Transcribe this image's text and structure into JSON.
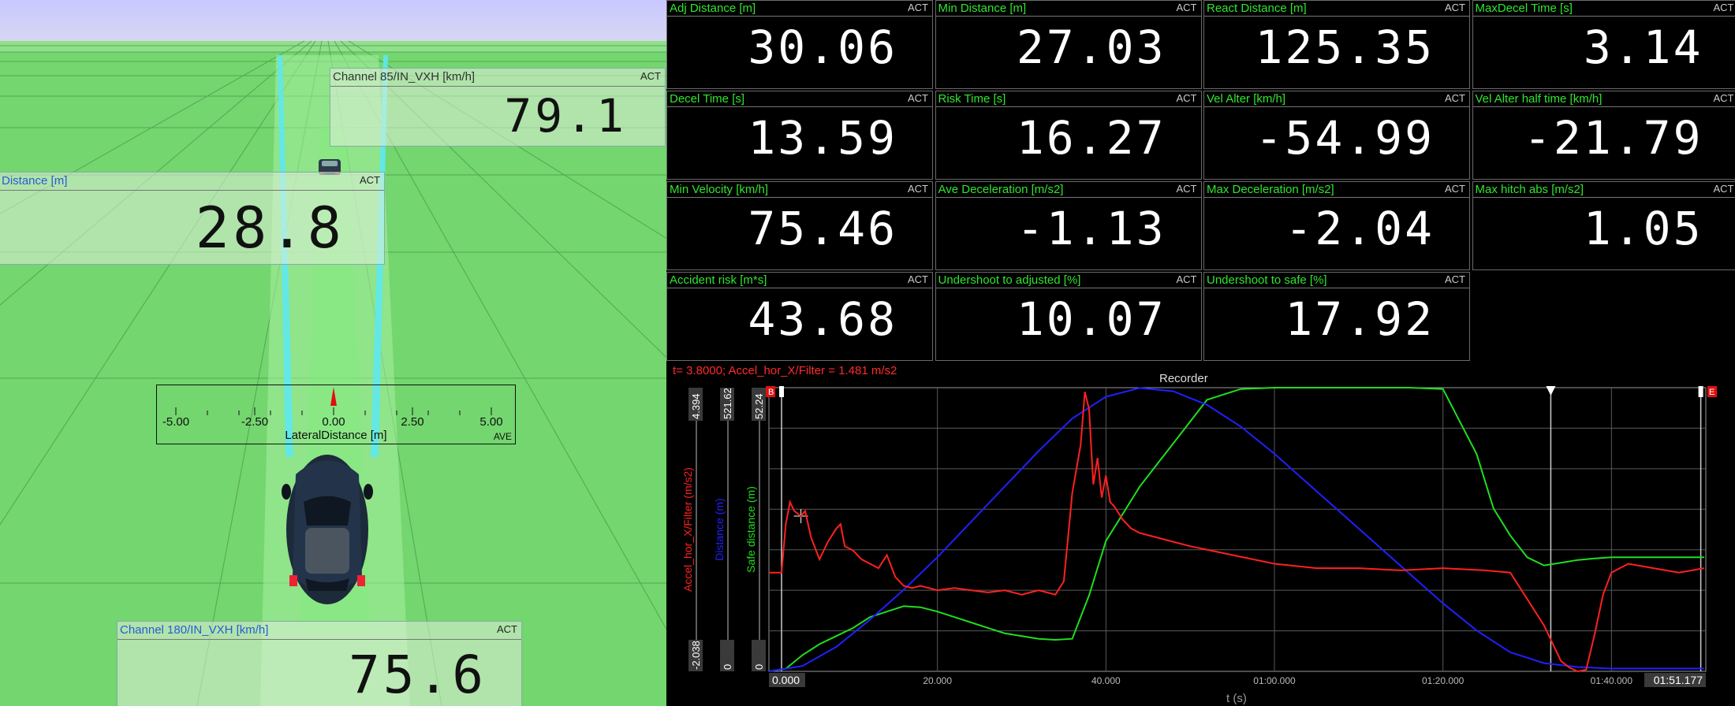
{
  "scene": {
    "ch85": {
      "title": "Channel 85/IN_VXH [km/h]",
      "flag": "ACT",
      "value": "79.1"
    },
    "dist": {
      "title": "Distance [m]",
      "flag": "ACT",
      "value": "28.8"
    },
    "ch180": {
      "title": "Channel 180/IN_VXH [km/h]",
      "flag": "ACT",
      "value": "75.6"
    },
    "lateral": {
      "label": "LateralDistance [m]",
      "flag": "AVE",
      "ticks": [
        "-5.00",
        "-2.50",
        "0.00",
        "2.50",
        "5.00"
      ],
      "value": 0.0
    }
  },
  "tiles": [
    {
      "title": "Adj Distance [m]",
      "flag": "ACT",
      "value": "30.06"
    },
    {
      "title": "Min Distance [m]",
      "flag": "ACT",
      "value": "27.03"
    },
    {
      "title": "React Distance [m]",
      "flag": "ACT",
      "value": "125.35"
    },
    {
      "title": "MaxDecel Time [s]",
      "flag": "ACT",
      "value": "3.14"
    },
    {
      "title": "Decel Time [s]",
      "flag": "ACT",
      "value": "13.59"
    },
    {
      "title": "Risk Time [s]",
      "flag": "ACT",
      "value": "16.27"
    },
    {
      "title": "Vel Alter [km/h]",
      "flag": "ACT",
      "value": "-54.99"
    },
    {
      "title": "Vel Alter half time [km/h]",
      "flag": "ACT",
      "value": "-21.79"
    },
    {
      "title": "Min Velocity [km/h]",
      "flag": "ACT",
      "value": "75.46"
    },
    {
      "title": "Ave Deceleration [m/s2]",
      "flag": "ACT",
      "value": "-1.13"
    },
    {
      "title": "Max Deceleration [m/s2]",
      "flag": "ACT",
      "value": "-2.04"
    },
    {
      "title": "Max hitch abs [m/s2]",
      "flag": "ACT",
      "value": "1.05"
    },
    {
      "title": "Accident risk [m*s]",
      "flag": "ACT",
      "value": "43.68"
    },
    {
      "title": "Undershoot to adjusted [%]",
      "flag": "ACT",
      "value": "10.07"
    },
    {
      "title": "Undershoot to safe [%]",
      "flag": "ACT",
      "value": "17.92"
    }
  ],
  "recorder": {
    "title": "Recorder",
    "cursor_text": "t= 3.8000; Accel_hor_X/Filter = 1.481 m/s2",
    "x_label": "t (s)",
    "marker_start": "B",
    "marker_end": "E",
    "time_start": "0.000",
    "time_end": "01:51.177",
    "colors": {
      "accel": "#ff2020",
      "distance": "#2020ff",
      "safe": "#20dd20"
    }
  },
  "chart_data": {
    "type": "line",
    "title": "Recorder",
    "xlabel": "t (s)",
    "x_ticks": [
      "0.000",
      "20.000",
      "40.000",
      "01:00.000",
      "01:20.000",
      "01:40.000",
      "01:51.177"
    ],
    "xlim": [
      0,
      111.2
    ],
    "axes": [
      {
        "name": "Accel_hor_X/Filter (m/s2)",
        "range": [
          "-2.038",
          "4.394"
        ],
        "color": "#ff2020"
      },
      {
        "name": "Distance (m)",
        "range": [
          "0",
          "521.62"
        ],
        "color": "#2020ff"
      },
      {
        "name": "Safe distance (m)",
        "range": [
          "0",
          "52.24"
        ],
        "color": "#20dd20"
      }
    ],
    "series": [
      {
        "name": "Accel_hor_X/Filter (m/s2)",
        "color": "#ff2020",
        "ylim": [
          -2.038,
          4.394
        ],
        "x": [
          0,
          1.5,
          2,
          2.5,
          3,
          3.8,
          4.3,
          5,
          6,
          7,
          8,
          8.5,
          9,
          10,
          11,
          12,
          13,
          14,
          15,
          15.5,
          16,
          17,
          18,
          20,
          22,
          24,
          26,
          28,
          30,
          31,
          32,
          33,
          34,
          35,
          35.5,
          36,
          37,
          37.5,
          38,
          38.5,
          39,
          39.5,
          40,
          40.5,
          41,
          42,
          43,
          44,
          46,
          48,
          50,
          55,
          60,
          65,
          70,
          75,
          80,
          85,
          88,
          90,
          92,
          94,
          95,
          96,
          97,
          98,
          99,
          100,
          102,
          105,
          108,
          111
        ],
        "y": [
          0.2,
          0.2,
          1.3,
          1.8,
          1.6,
          1.48,
          1.6,
          1.0,
          0.5,
          0.9,
          1.2,
          1.3,
          0.8,
          0.7,
          0.5,
          0.4,
          0.3,
          0.6,
          0.1,
          0.0,
          -0.1,
          -0.15,
          -0.1,
          -0.2,
          -0.15,
          -0.2,
          -0.25,
          -0.2,
          -0.3,
          -0.25,
          -0.2,
          -0.25,
          -0.3,
          0.0,
          1.0,
          2.0,
          3.1,
          4.3,
          3.9,
          2.2,
          2.8,
          1.9,
          2.4,
          1.8,
          1.7,
          1.4,
          1.2,
          1.1,
          1.0,
          0.9,
          0.8,
          0.6,
          0.4,
          0.3,
          0.3,
          0.25,
          0.3,
          0.25,
          0.2,
          -0.4,
          -1.0,
          -1.8,
          -1.95,
          -2.04,
          -2.0,
          -1.2,
          -0.3,
          0.2,
          0.4,
          0.3,
          0.2,
          0.3
        ]
      },
      {
        "name": "Distance (m)",
        "color": "#2020ff",
        "ylim": [
          0,
          521.62
        ],
        "x": [
          0,
          4,
          8,
          12,
          16,
          20,
          24,
          28,
          32,
          36,
          40,
          44,
          48,
          52,
          56,
          60,
          64,
          68,
          72,
          76,
          80,
          84,
          88,
          92,
          96,
          100,
          104,
          108,
          111
        ],
        "y": [
          0,
          10,
          45,
          95,
          150,
          210,
          275,
          340,
          405,
          465,
          505,
          521,
          515,
          490,
          450,
          400,
          345,
          290,
          235,
          180,
          125,
          75,
          35,
          15,
          8,
          5,
          5,
          5,
          5
        ]
      },
      {
        "name": "Safe distance (m)",
        "color": "#20dd20",
        "ylim": [
          0,
          52.24
        ],
        "x": [
          0,
          2,
          4,
          6,
          8,
          10,
          12,
          14,
          16,
          18,
          20,
          22,
          24,
          26,
          28,
          30,
          32,
          34,
          36,
          38,
          40,
          42,
          44,
          46,
          48,
          50,
          52,
          56,
          60,
          64,
          68,
          72,
          76,
          80,
          84,
          86,
          88,
          90,
          92,
          94,
          96,
          98,
          100,
          104,
          108,
          111
        ],
        "y": [
          0,
          0.5,
          3,
          5,
          6.5,
          8,
          10,
          11,
          12,
          11.8,
          11,
          10,
          9,
          8,
          7,
          6.5,
          6,
          5.8,
          6,
          14,
          24,
          29,
          34,
          38,
          42,
          46,
          50,
          52,
          52.24,
          52.24,
          52.24,
          52.24,
          52.24,
          52,
          40,
          30,
          25,
          21,
          19.5,
          20,
          20.5,
          20.8,
          21,
          21,
          21,
          21
        ]
      }
    ]
  }
}
